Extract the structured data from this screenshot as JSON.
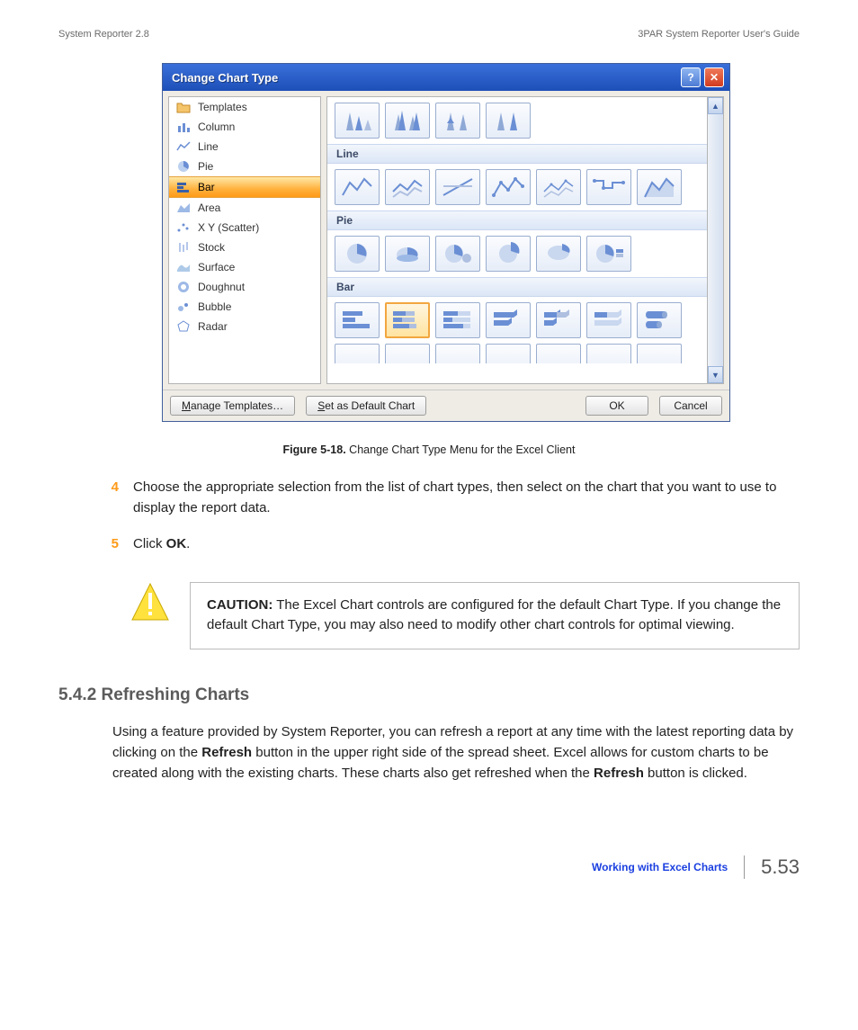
{
  "header": {
    "left": "System Reporter 2.8",
    "right": "3PAR System Reporter User's Guide"
  },
  "dialog": {
    "title": "Change Chart Type",
    "sidebar": [
      {
        "label": "Templates"
      },
      {
        "label": "Column"
      },
      {
        "label": "Line"
      },
      {
        "label": "Pie"
      },
      {
        "label": "Bar"
      },
      {
        "label": "Area"
      },
      {
        "label": "X Y (Scatter)"
      },
      {
        "label": "Stock"
      },
      {
        "label": "Surface"
      },
      {
        "label": "Doughnut"
      },
      {
        "label": "Bubble"
      },
      {
        "label": "Radar"
      }
    ],
    "categories": {
      "line": "Line",
      "pie": "Pie",
      "bar": "Bar"
    },
    "buttons": {
      "manage": "Manage Templates…",
      "default": "Set as Default Chart",
      "ok": "OK",
      "cancel": "Cancel"
    }
  },
  "figure": {
    "label": "Figure 5-18.",
    "caption": "Change Chart Type Menu for the Excel Client"
  },
  "steps": {
    "s4_num": "4",
    "s4_text": "Choose the appropriate selection from the list of chart types, then select on the chart that you want to use to display the report data.",
    "s5_num": "5",
    "s5_pre": "Click ",
    "s5_bold": "OK",
    "s5_post": "."
  },
  "caution": {
    "label": "CAUTION:",
    "text": " The Excel Chart controls are configured for the default Chart Type. If you change the default Chart Type, you may also need to modify other chart controls for optimal viewing."
  },
  "section": {
    "heading": "5.4.2 Refreshing Charts",
    "p1a": "Using a feature provided by System Reporter, you can refresh a report at any time with the latest reporting data by clicking on the ",
    "p1b": "Refresh",
    "p1c": " button in the upper right side of the spread sheet. Excel allows for custom charts to be created along with the existing charts. These charts also get refreshed when the ",
    "p1d": "Refresh",
    "p1e": " button is clicked."
  },
  "footer": {
    "link": "Working with Excel Charts",
    "page": "5.53"
  }
}
